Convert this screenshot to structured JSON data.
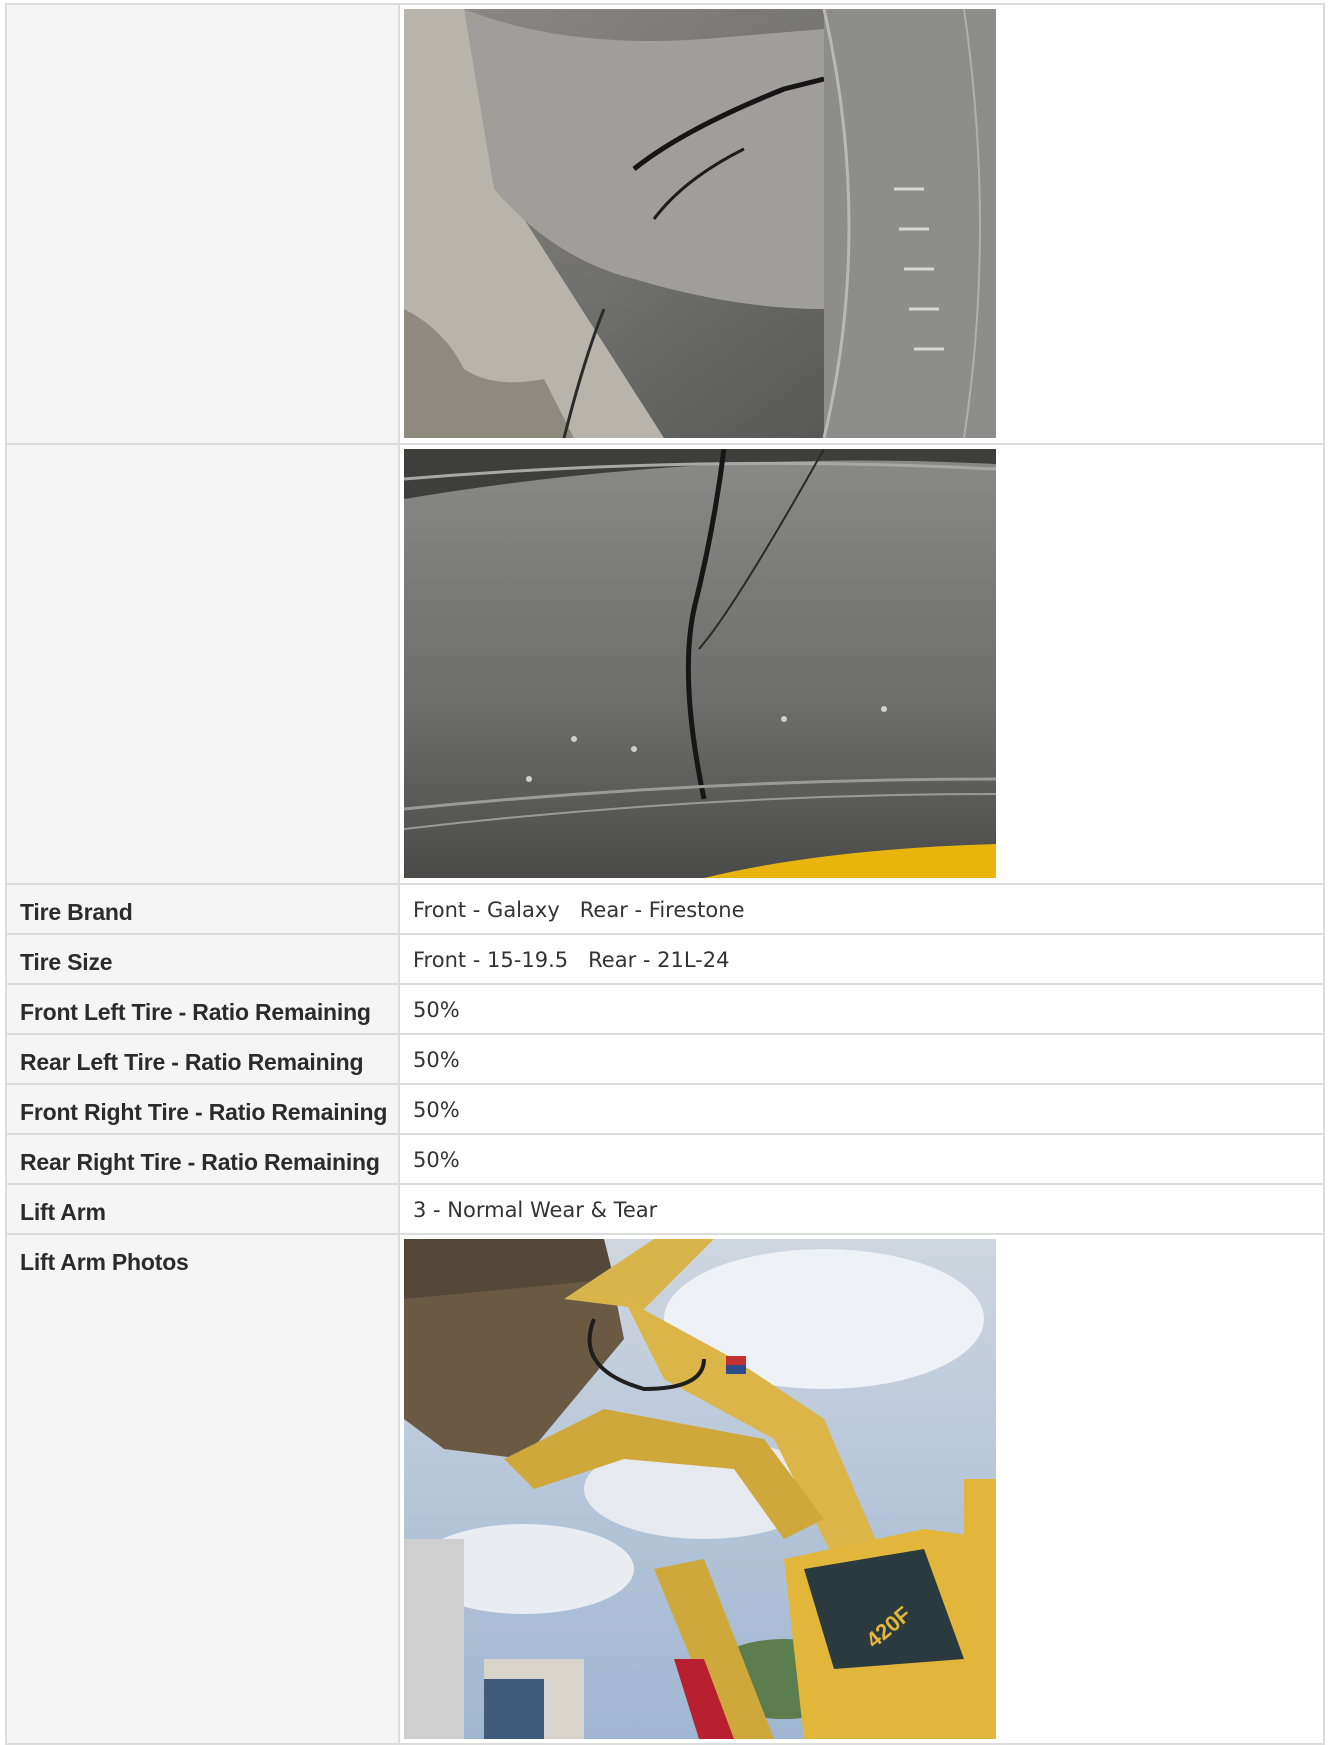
{
  "rows": [
    {
      "label": "Tire Brand",
      "value": "Front - Galaxy   Rear - Firestone"
    },
    {
      "label": "Tire Size",
      "value": "Front - 15-19.5   Rear - 21L-24"
    },
    {
      "label": "Front Left Tire - Ratio Remaining",
      "value": "50%"
    },
    {
      "label": "Rear Left Tire - Ratio Remaining",
      "value": "50%"
    },
    {
      "label": "Front Right Tire - Ratio Remaining",
      "value": "50%"
    },
    {
      "label": "Rear Right Tire - Ratio Remaining",
      "value": "50%"
    },
    {
      "label": "Lift Arm",
      "value": "3 - Normal Wear & Tear"
    }
  ],
  "lift_arm_photos": {
    "label": "Lift Arm Photos"
  }
}
